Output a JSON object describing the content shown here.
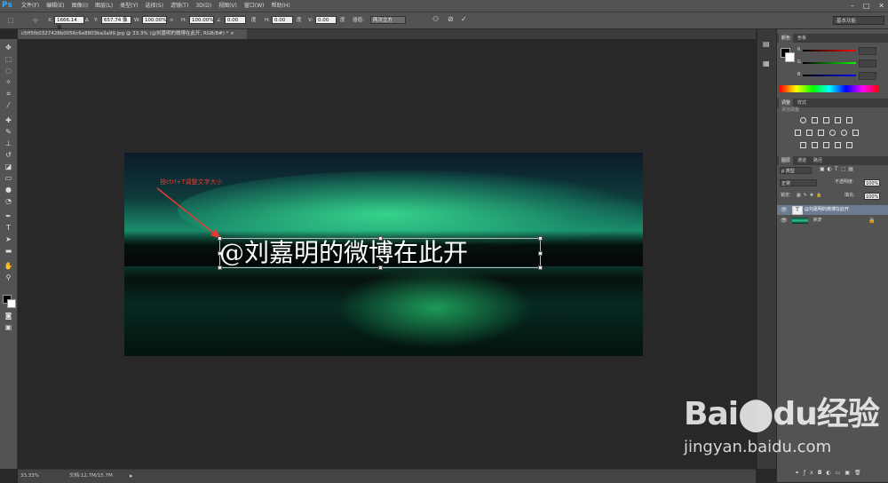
{
  "app": {
    "logo": "Ps"
  },
  "menu": {
    "items": [
      "文件(F)",
      "编辑(E)",
      "图像(I)",
      "图层(L)",
      "类型(Y)",
      "选择(S)",
      "滤镜(T)",
      "3D(D)",
      "视图(V)",
      "窗口(W)",
      "帮助(H)"
    ],
    "window_controls": [
      "–",
      "□",
      "✕"
    ]
  },
  "options": {
    "x_label": "X:",
    "x_value": "1666.14 像",
    "y_label": "Y:",
    "y_value": "657.74 像",
    "w_label": "W:",
    "w_value": "100.00%",
    "h_label": "H:",
    "h_value": "100.00%",
    "angle_value": "0.00",
    "angle_unit": "度",
    "hskew_label": "H:",
    "hskew_value": "0.00",
    "hskew_unit": "度",
    "vskew_label": "V:",
    "vskew_value": "0.00",
    "vskew_unit": "度",
    "interp_label": "插值:",
    "interp_value": "两次立方",
    "workspace": "基本功能",
    "cancel_icon": "⊘",
    "commit_icon": "✓"
  },
  "document": {
    "tab_title": "c5ff5fb0327428b0056c6e8803ba3a99.jpg @ 33.3% (@刘嘉明的微博在此开, RGB/8#) * ×",
    "overlay_text": "@刘嘉明的微博在此开",
    "annotation": "按ctrl+T调整文字大小",
    "annotation_color": "#e8392f"
  },
  "status": {
    "zoom": "33.33%",
    "doc_info": "文档:12.7M/15.7M"
  },
  "panels": {
    "color_tabs": [
      "颜色",
      "色板"
    ],
    "rgb_labels": [
      "R",
      "G",
      "B"
    ],
    "adjust_tabs": [
      "调整",
      "样式"
    ],
    "adjust_add": "添加调整",
    "layer_tabs": [
      "图层",
      "通道",
      "路径"
    ],
    "filter_kind": "ρ 类型",
    "blend_mode": "正常",
    "opacity_label": "不透明度:",
    "opacity_value": "100%",
    "lock_label": "锁定:",
    "fill_label": "填充:",
    "fill_value": "100%",
    "layers": [
      {
        "name": "@刘嘉明的微博在此开",
        "type": "T"
      },
      {
        "name": "背景",
        "type": "image"
      }
    ]
  },
  "watermark": {
    "logo": "Bai⬤du经验",
    "url": "jingyan.baidu.com"
  }
}
